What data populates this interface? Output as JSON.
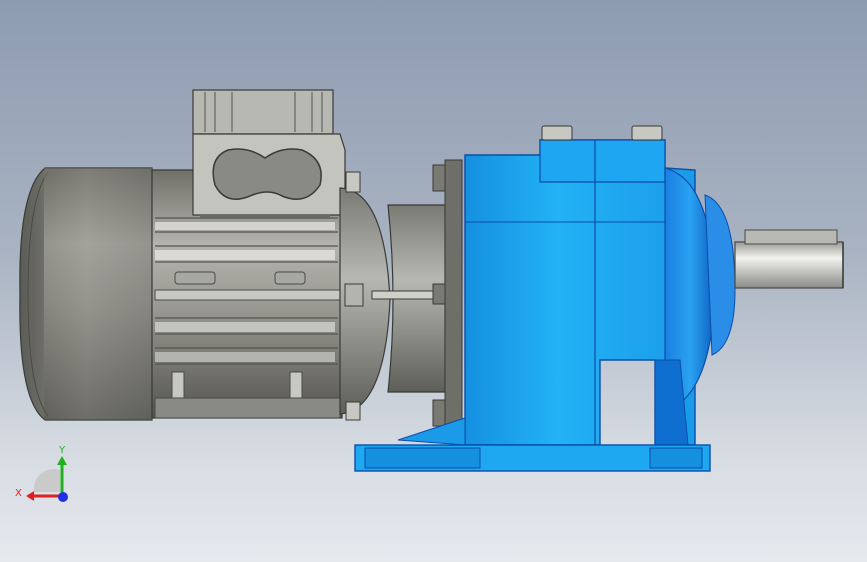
{
  "viewport": {
    "model": "geared-motor-assembly",
    "colors": {
      "gearbox_blue": "#1aa8f0",
      "gearbox_shadow": "#0f7dd0",
      "motor_gray": "#8a8a84",
      "shaft_silver": "#d9d9d6"
    }
  },
  "triad": {
    "x_label": "X",
    "y_label": "Y",
    "x_color": "#e02020",
    "y_color": "#20b020",
    "z_color": "#2030e0"
  }
}
